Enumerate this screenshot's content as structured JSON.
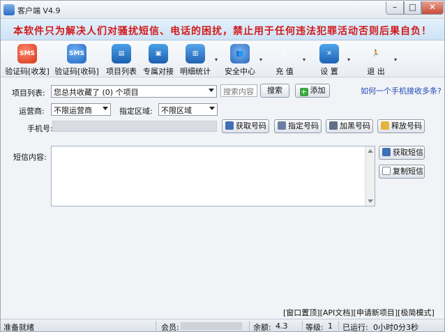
{
  "window": {
    "title": "客户端 V4.9",
    "min": "–",
    "max": "□",
    "close": "✕"
  },
  "banner": {
    "text": "本软件只为解决人们对骚扰短信、电话的困扰，禁止用于任何违法犯罪活动否则后果自负！"
  },
  "toolbar": {
    "items": [
      {
        "label": "验证码[收发]",
        "icon": "sms-red-icon",
        "glyph": "SMS"
      },
      {
        "label": "验证码[收码]",
        "icon": "sms-blue-icon",
        "glyph": "SMS"
      },
      {
        "label": "项目列表",
        "icon": "monitor-icon",
        "glyph": "▤"
      },
      {
        "label": "专属对接",
        "icon": "screen-icon",
        "glyph": "▣"
      },
      {
        "label": "明细统计",
        "icon": "bar-chart-icon",
        "glyph": "▥"
      },
      {
        "label": "安全中心",
        "icon": "users-icon",
        "glyph": "👥"
      },
      {
        "label": "充 值",
        "icon": "pdf-icon",
        "glyph": "⅄"
      },
      {
        "label": "设 置",
        "icon": "tools-icon",
        "glyph": "✕"
      },
      {
        "label": "退 出",
        "icon": "exit-run-icon",
        "glyph": "🏃"
      }
    ],
    "dropdown_glyph": "▾"
  },
  "form": {
    "project_label": "项目列表:",
    "project_value": "您总共收藏了 (0) 个项目",
    "search_placeholder": "搜索内容",
    "search_button": "搜索",
    "add_button": "添加",
    "help_link": "如何一个手机接收多条?",
    "operator_label": "运营商:",
    "operator_value": "不限运营商",
    "region_label": "指定区域:",
    "region_value": "不限区域",
    "phone_label": "手机号:",
    "get_number": "获取号码",
    "assign_number": "指定号码",
    "blacklist_number": "加黑号码",
    "release_number": "释放号码",
    "sms_label": "短信内容:",
    "get_sms": "获取短信",
    "copy_sms": "复制短信"
  },
  "bottom_links": "[窗口置顶][API文档][申请新项目][极简模式]",
  "status": {
    "ready": "准备就绪",
    "member_label": "会员:",
    "balance_label": "余额:",
    "balance_value": "4.3",
    "level_label": "等级:",
    "level_value": "1",
    "runtime_label": "已运行:",
    "runtime_value": "0小时0分3秒"
  }
}
